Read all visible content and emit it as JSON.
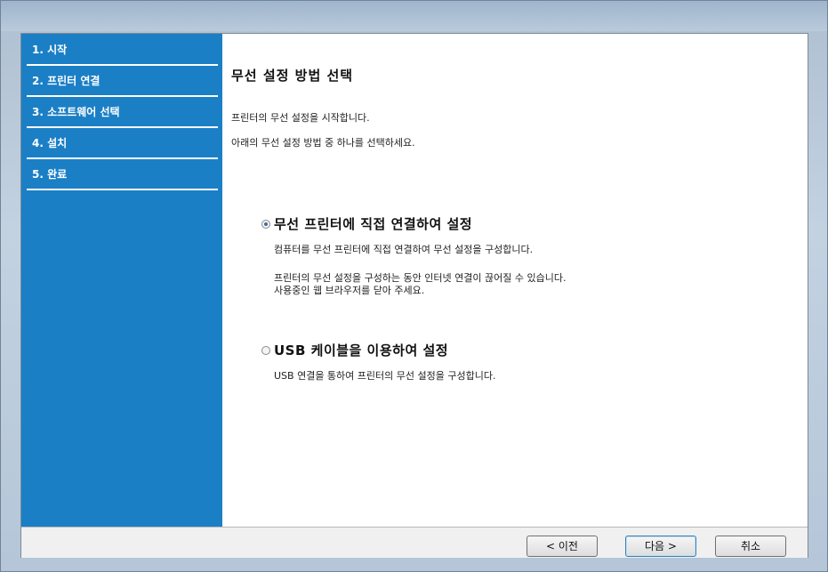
{
  "sidebar": {
    "items": [
      {
        "label": "1. 시작"
      },
      {
        "label": "2. 프린터 연결"
      },
      {
        "label": "3. 소프트웨어 선택"
      },
      {
        "label": "4. 설치"
      },
      {
        "label": "5. 완료"
      }
    ]
  },
  "main": {
    "title": "무선 설정 방법 선택",
    "intro_line1": "프린터의 무선 설정을 시작합니다.",
    "intro_line2": "아래의 무선 설정 방법 중 하나를 선택하세요.",
    "options": [
      {
        "label": "무선 프린터에 직접 연결하여 설정",
        "selected": true,
        "desc1": "컴퓨터를 무선 프린터에 직접 연결하여 무선 설정을 구성합니다.",
        "desc2": "프린터의 무선 설정을 구성하는 동안 인터넷 연결이 끊어질 수 있습니다.",
        "desc3": "사용중인 웹 브라우저를 닫아 주세요."
      },
      {
        "label": "USB 케이블을 이용하여 설정",
        "selected": false,
        "desc1": "USB 연결을 통하여 프린터의 무선 설정을 구성합니다."
      }
    ]
  },
  "footer": {
    "back_label": "< 이전",
    "next_label": "다음 >",
    "cancel_label": "취소"
  }
}
